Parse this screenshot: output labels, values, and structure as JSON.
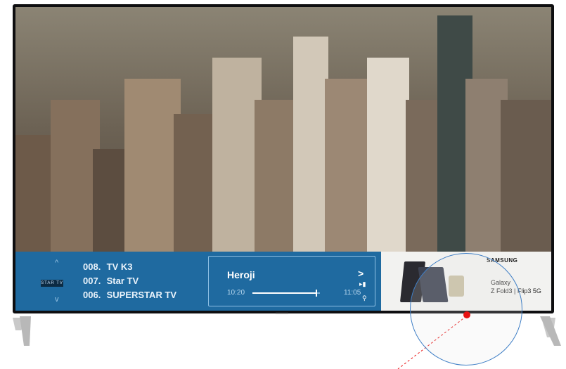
{
  "channels": {
    "items": [
      {
        "number": "008.",
        "name": "TV K3"
      },
      {
        "number": "007.",
        "name": "Star TV"
      },
      {
        "number": "006.",
        "name": "SUPERSTAR TV"
      }
    ],
    "logo_text": "STAR TV",
    "up_arrow": "^",
    "down_arrow": "v"
  },
  "now_playing": {
    "title": "Heroji",
    "start_time": "10:20",
    "end_time": "11:05",
    "progress": 0.95,
    "next_chevron": ">"
  },
  "ad": {
    "brand": "SAMSUNG",
    "line1": "Galaxy",
    "line2": "Z Fold3 | Flip3 5G"
  },
  "colors": {
    "panel_blue": "#1f6aa0",
    "highlight_dot": "#e81212",
    "magnifier_border": "#3f7fc6"
  }
}
